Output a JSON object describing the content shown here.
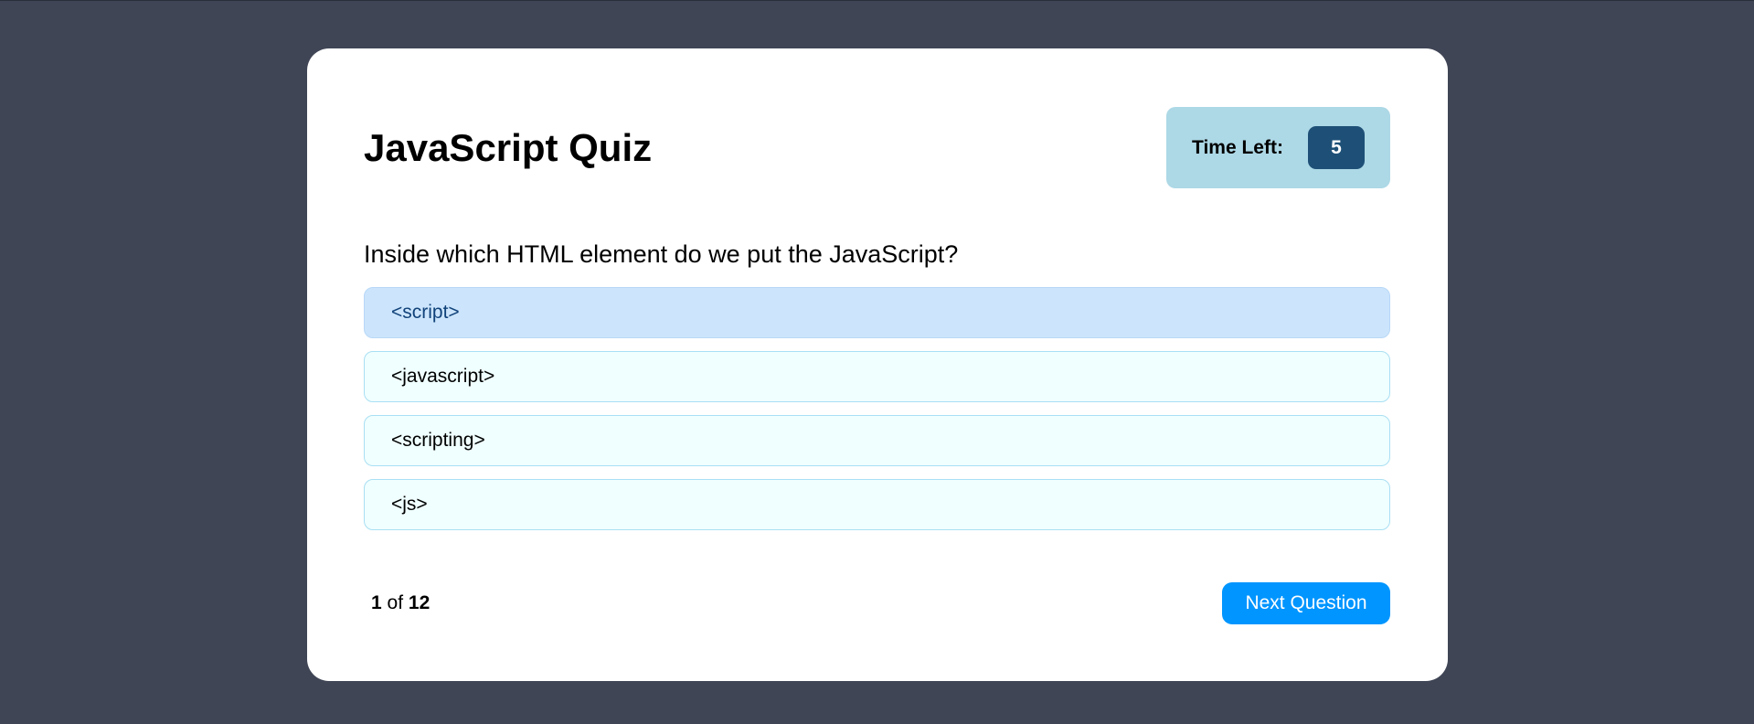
{
  "quiz": {
    "title": "JavaScript Quiz",
    "timer": {
      "label": "Time Left:",
      "value": "5"
    },
    "question": "Inside which HTML element do we put the JavaScript?",
    "answers": [
      {
        "label": "<script>",
        "selected": true
      },
      {
        "label": "<javascript>",
        "selected": false
      },
      {
        "label": "<scripting>",
        "selected": false
      },
      {
        "label": "<js>",
        "selected": false
      }
    ],
    "progress": {
      "current": "1",
      "separator": "of",
      "total": "12"
    },
    "next_button_label": "Next Question"
  },
  "colors": {
    "page_background": "#3f4555",
    "card_background": "#ffffff",
    "timer_background": "#add8e6",
    "timer_value_background": "#1e5077",
    "answer_background": "#f0ffff",
    "answer_selected_background": "#cce5fc",
    "next_button_background": "#0095ff"
  }
}
